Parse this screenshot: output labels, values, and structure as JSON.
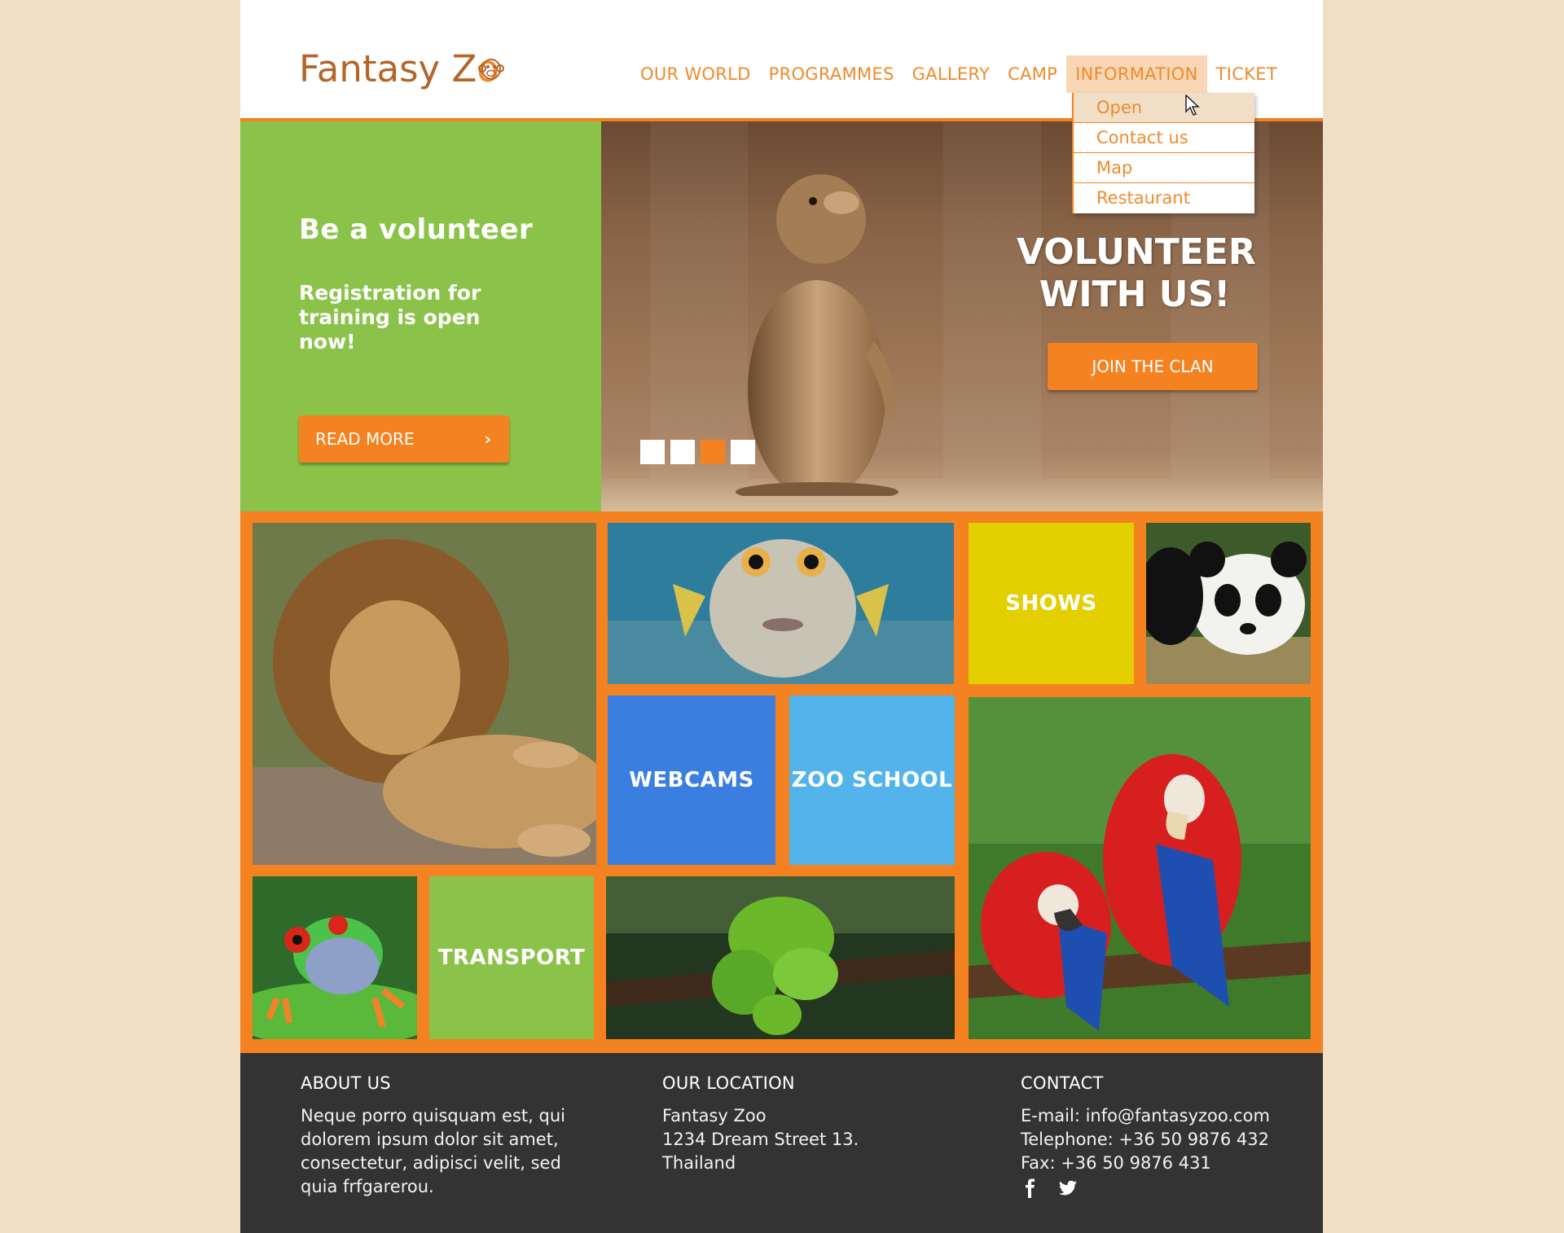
{
  "header": {
    "logo_text_main": "Fantasy Z",
    "logo_text_accent": "o",
    "logo_icon": "monkey-face-icon",
    "nav": [
      "OUR WORLD",
      "PROGRAMMES",
      "GALLERY",
      "CAMP",
      "INFORMATION",
      "TICKET"
    ],
    "active_nav": "INFORMATION"
  },
  "dropdown": {
    "items": [
      "Open",
      "Contact us",
      "Map",
      "Restaurant"
    ],
    "hovered": "Open"
  },
  "hero": {
    "title": "Be a volunteer",
    "text": "Registration for training is open now!",
    "read_more": "READ MORE",
    "read_more_icon": "chevron-right-icon",
    "cta_line1": "VOLUNTEER",
    "cta_line2": "WITH US!",
    "join_button": "JOIN THE CLAN",
    "slider_total": 4,
    "slider_active": 3
  },
  "tiles": {
    "shows": "SHOWS",
    "webcams": "WEBCAMS",
    "zoo_school": "ZOO SCHOOL",
    "transport": "TRANSPORT"
  },
  "footer": {
    "about": {
      "heading": "ABOUT US",
      "lines": [
        "Neque porro quisquam est, qui",
        "dolorem ipsum dolor sit amet,",
        "consectetur, adipisci velit, sed",
        "quia frfgarerou."
      ]
    },
    "location": {
      "heading": "OUR LOCATION",
      "lines": [
        "Fantasy Zoo",
        "1234 Dream Street 13.",
        "Thailand"
      ]
    },
    "contact": {
      "heading": "CONTACT",
      "lines": [
        "E-mail: info@fantasyzoo.com",
        "Telephone: +36 50 9876 432",
        "Fax: +36 50 9876 431"
      ]
    },
    "social": [
      "facebook-icon",
      "twitter-icon"
    ]
  },
  "colors": {
    "accent_orange": "#f58220",
    "green": "#8bc34a",
    "yellow": "#e3cf00",
    "blue": "#3a7fe0",
    "light_blue": "#52b4ea",
    "footer_bg": "#333333",
    "page_bg": "#f0dfc6"
  }
}
